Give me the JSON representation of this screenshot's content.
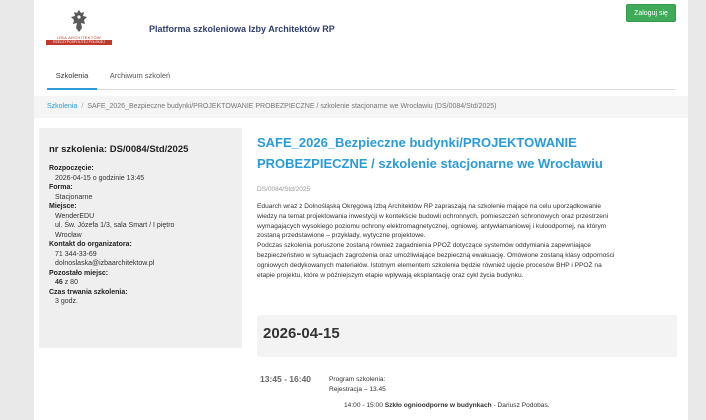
{
  "header": {
    "logo_text_top": "IZBA ARCHITEKTÓW",
    "logo_text_bottom": "RZECZYPOSPOLITEJ POLSKIEJ",
    "site_title": "Platforma szkoleniowa Izby Architektów RP",
    "login_label": "Zaloguj się"
  },
  "tabs": [
    {
      "label": "Szkolenia",
      "active": true
    },
    {
      "label": "Archiwum szkoleń",
      "active": false
    }
  ],
  "breadcrumb": {
    "root": "Szkolenia",
    "separator": "/",
    "current": "SAFE_2026_Bezpieczne budynki/PROJEKTOWANIE PROBEZPIECZNE / szkolenie stacjonarne we Wrocławiu (DS/0084/Std/2025)"
  },
  "sidebar": {
    "number_label": "nr szkolenia: DS/0084/Std/2025",
    "start_label": "Rozpoczęcie:",
    "start_value": "2026-04-15 o godzinie 13:45",
    "form_label": "Forma:",
    "form_value": "Stacjonarne",
    "place_label": "Miejsce:",
    "place_lines": [
      "WenderEDU",
      "ul. Św. Józefa 1/3, sala Smart / I piętro",
      "Wrocław"
    ],
    "contact_label": "Kontakt do organizatora:",
    "contact_phone": "71 344-33-69",
    "contact_email": "dolnoslaska@izbaarchitektow.pl",
    "seats_label": "Pozostało miejsc:",
    "seats_remaining": "46",
    "seats_total": " z 80",
    "duration_label": "Czas trwania szkolenia:",
    "duration_value": "3 godz."
  },
  "main": {
    "title": "SAFE_2026_Bezpieczne budynki/PROJEKTOWANIE PROBEZPIECZNE / szkolenie stacjonarne we Wrocławiu",
    "code": "DS/0084/Std/2025",
    "desc_lines": [
      "Eduarch wraz z Dolnośląską Okręgową Izbą Architektów RP zapraszają na szkolenie mające na celu uporządkowanie",
      "wiedzy na temat projektowania inwestycji w kontekście budowli ochronnych, pomieszczeń schronowych oraz przestrzeni",
      "wymagających wysokiego poziomu ochrony elektromagnetycznej, ogniowej, antywłamaniowej i kuloodpornej, na którym",
      "zostaną przedstawione – przykłady, wytyczne projektowe.",
      "Podczas szkolenia poruszone zostaną również zagadnienia PPOŻ dotyczące systemów oddymiania zapewniające",
      "bezpieczeństwo w sytuacjach zagrożenia oraz umożliwiające bezpieczną ewakuację. Omówione zostaną klasy odporności",
      "ogniowych dedykowanych materiałów. Istotnym elementem szkolenia będzie również ujęcie procesów BHP i PPOŻ na",
      "etapie projektu, które w późniejszym etapie wpływają eksplantację oraz cykl życia budynku."
    ],
    "date": "2026-04-15",
    "schedule": {
      "time": "13:45 - 16:40",
      "program_label": "Program szkolenia:",
      "registration": "Rejestracja – 13.45",
      "item_time": "14:00 - 15:00 ",
      "item_title": "Szkło ognioodporne w budynkach",
      "item_speaker": " - Dariusz Podobas."
    }
  }
}
